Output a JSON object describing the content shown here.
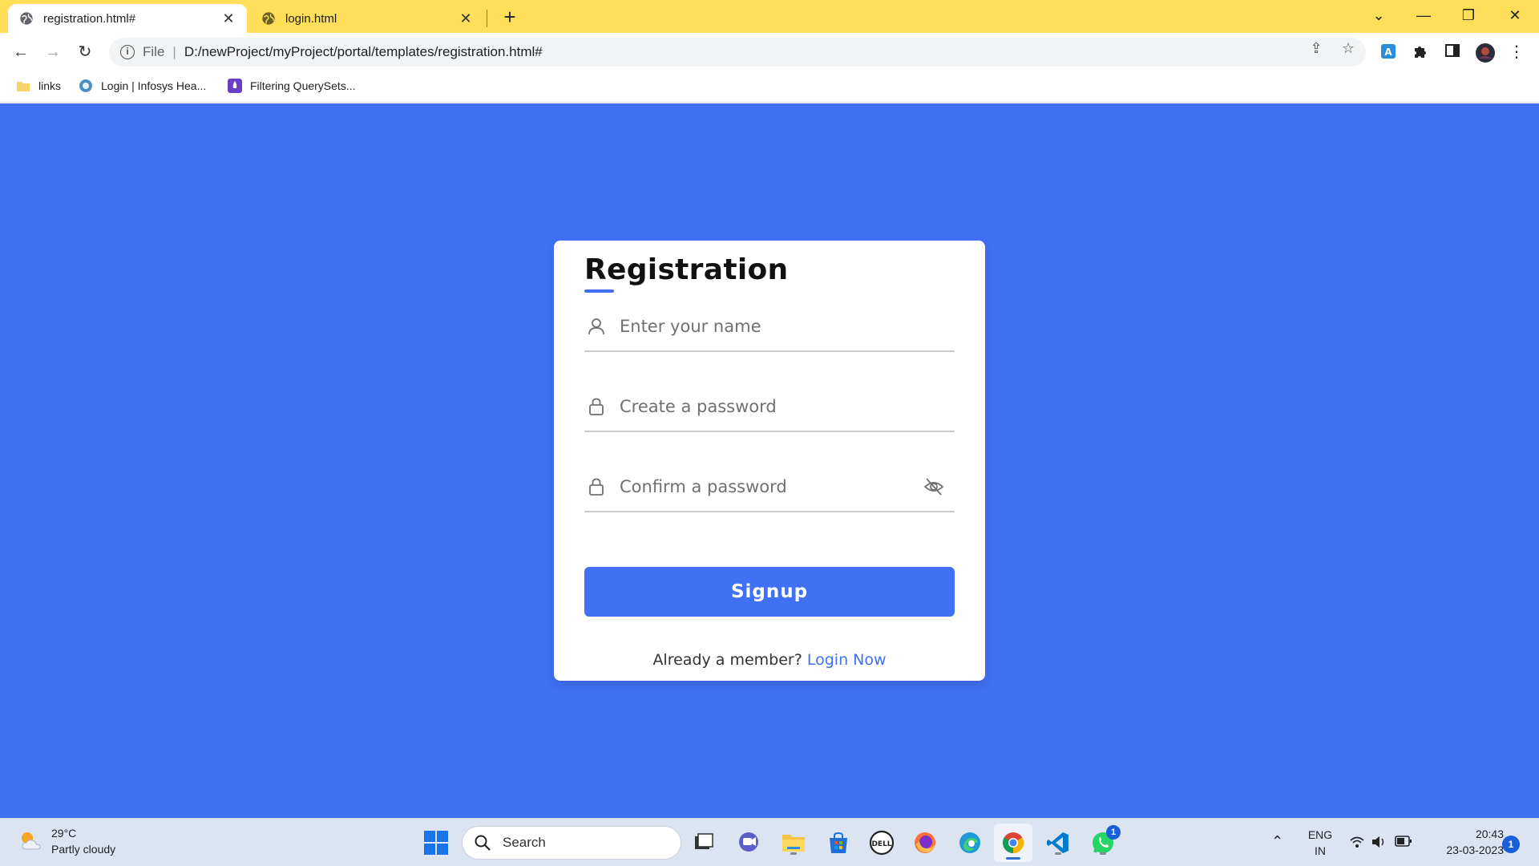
{
  "browser": {
    "tabs": [
      {
        "title": "registration.html#",
        "active": true
      },
      {
        "title": "login.html",
        "active": false
      }
    ],
    "new_tab_label": "+",
    "address": {
      "scheme": "File",
      "url": "D:/newProject/myProject/portal/templates/registration.html#"
    },
    "bookmarks": [
      {
        "label": "links",
        "icon": "folder-icon"
      },
      {
        "label": "Login | Infosys Hea...",
        "icon": "infosys-favicon"
      },
      {
        "label": "Filtering QuerySets...",
        "icon": "rocket-favicon"
      }
    ],
    "accent_color": "#ffde59"
  },
  "page": {
    "background_color": "#4070f4",
    "form": {
      "title": "Registration",
      "fields": [
        {
          "name": "name",
          "placeholder": "Enter your name",
          "value": "",
          "icon": "user-icon"
        },
        {
          "name": "password",
          "placeholder": "Create a password",
          "value": "",
          "icon": "lock-icon"
        },
        {
          "name": "confirm_password",
          "placeholder": "Confirm a password",
          "value": "",
          "icon": "lock-icon",
          "trailing_icon": "eye-slash-icon"
        }
      ],
      "submit_label": "Signup",
      "footer_text": "Already a member?",
      "footer_link": "Login Now"
    }
  },
  "taskbar": {
    "weather": {
      "temperature": "29°C",
      "condition": "Partly cloudy"
    },
    "search_label": "Search",
    "apps": [
      "task-view-icon",
      "teams-chat-icon",
      "file-explorer-icon",
      "microsoft-store-icon",
      "dell-icon",
      "firefox-icon",
      "edge-icon",
      "chrome-icon",
      "vscode-icon",
      "whatsapp-icon"
    ],
    "whatsapp_badge": "1",
    "language": {
      "line1": "ENG",
      "line2": "IN"
    },
    "clock": {
      "time": "20:43",
      "date": "23-03-2023"
    },
    "notification_count": "1"
  }
}
